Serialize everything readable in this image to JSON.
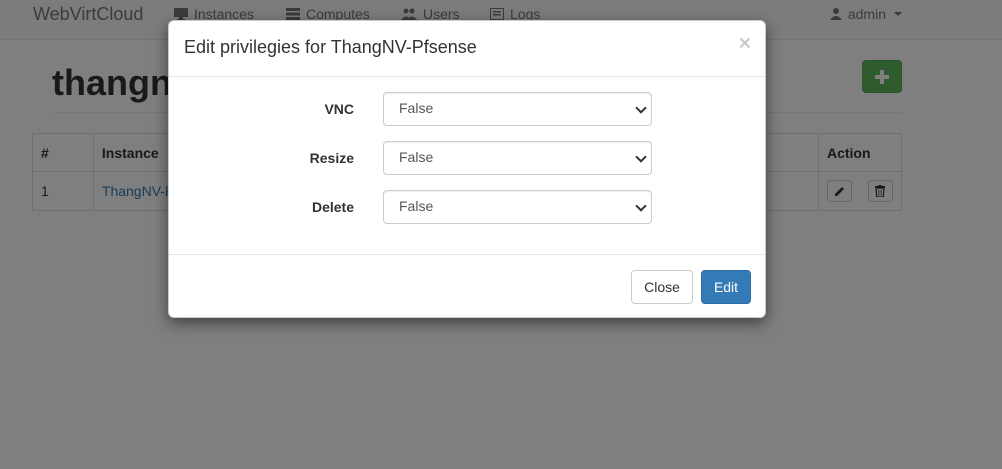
{
  "navbar": {
    "brand": "WebVirtCloud",
    "items": [
      {
        "label": "Instances",
        "icon": "desktop-icon"
      },
      {
        "label": "Computes",
        "icon": "server-icon"
      },
      {
        "label": "Users",
        "icon": "users-icon"
      },
      {
        "label": "Logs",
        "icon": "list-icon"
      }
    ],
    "user": {
      "label": "admin",
      "icon": "user-icon"
    }
  },
  "page": {
    "title": "thangnv",
    "add_icon": "plus-icon"
  },
  "table": {
    "headers": [
      "#",
      "Instance",
      "",
      "Action"
    ],
    "rows": [
      {
        "num": "1",
        "instance": "ThangNV-Pfsense"
      }
    ]
  },
  "modal": {
    "title": "Edit privilegies for ThangNV-Pfsense",
    "close_symbol": "×",
    "fields": [
      {
        "label": "VNC",
        "value": "False"
      },
      {
        "label": "Resize",
        "value": "False"
      },
      {
        "label": "Delete",
        "value": "False"
      }
    ],
    "buttons": {
      "close": "Close",
      "edit": "Edit"
    }
  },
  "colors": {
    "primary": "#337ab7",
    "success": "#5cb85c",
    "backdrop": "rgba(0,0,0,0.5)"
  }
}
